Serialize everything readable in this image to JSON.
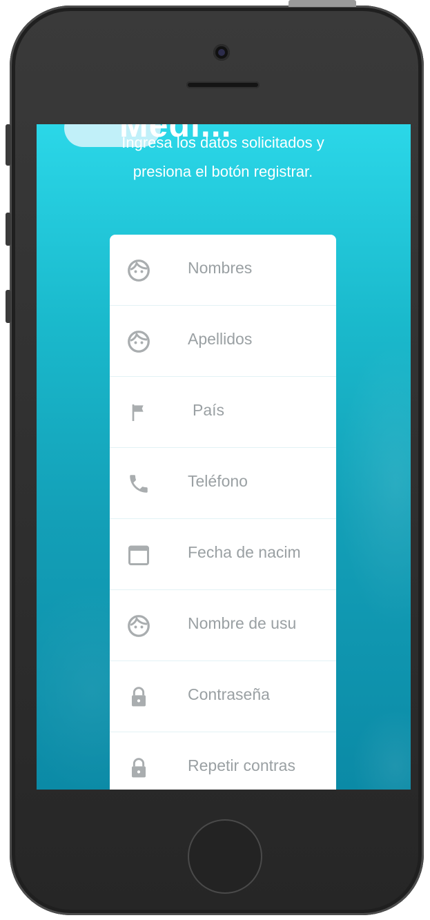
{
  "app": {
    "logo_text": "Medi..."
  },
  "intro_text": "Ingresa los datos solicitados y presiona el botón registrar.",
  "form": {
    "fields": [
      {
        "placeholder": "Nombres",
        "icon": "face-icon"
      },
      {
        "placeholder": "Apellidos",
        "icon": "face-icon"
      },
      {
        "placeholder": "País",
        "icon": "flag-icon"
      },
      {
        "placeholder": "Teléfono",
        "icon": "phone-icon"
      },
      {
        "placeholder": "Fecha de nacim",
        "icon": "calendar-icon"
      },
      {
        "placeholder": "Nombre de usu",
        "icon": "face-icon"
      },
      {
        "placeholder": "Contraseña",
        "icon": "lock-icon"
      },
      {
        "placeholder": "Repetir contras",
        "icon": "lock-icon"
      }
    ]
  },
  "colors": {
    "accent_top": "#2bd7e8",
    "accent_bottom": "#0b8aa6",
    "icon": "#a9adaf"
  }
}
